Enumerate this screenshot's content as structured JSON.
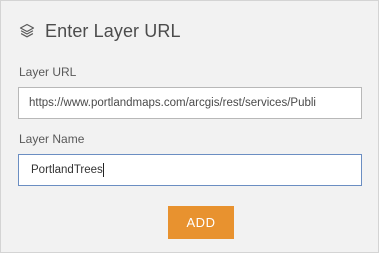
{
  "header": {
    "icon": "layers-icon",
    "title": "Enter Layer URL"
  },
  "form": {
    "url_label": "Layer URL",
    "url_value": "https://www.portlandmaps.com/arcgis/rest/services/Publi",
    "name_label": "Layer Name",
    "name_value": "PortlandTrees",
    "add_label": "ADD"
  },
  "colors": {
    "panel_bg": "#f2f2f2",
    "accent_button": "#e8922f",
    "focus_border": "#6b8ec2"
  }
}
